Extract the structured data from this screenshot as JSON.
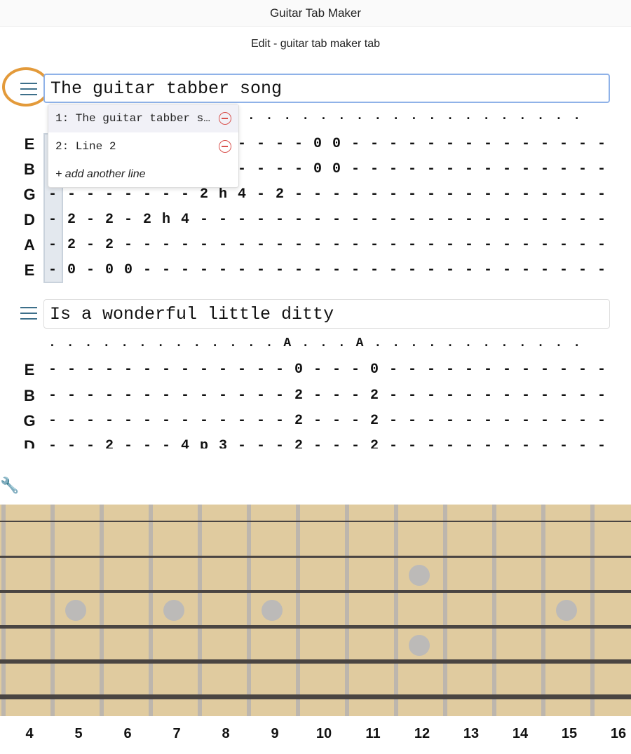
{
  "app_title": "Guitar Tab Maker",
  "page_title": "Edit - guitar tab maker tab",
  "dropdown": {
    "items": [
      {
        "label": "1: The guitar tabber s…"
      },
      {
        "label": "2: Line 2"
      }
    ],
    "add_label": "+  add another line"
  },
  "lines": [
    {
      "title": "The guitar tabber song",
      "focused": true,
      "dots": "..............................",
      "strings": [
        {
          "name": "E",
          "notes": "--------------00--------------"
        },
        {
          "name": "B",
          "notes": "--------------00--------------"
        },
        {
          "name": "G",
          "notes": "--------2h4-2-----------------"
        },
        {
          "name": "D",
          "notes": "-2-2-2h4----------------------"
        },
        {
          "name": "A",
          "notes": "-2-2--------------------------"
        },
        {
          "name": "E",
          "notes": "-0-00-------------------------"
        }
      ]
    },
    {
      "title": "Is a wonderful little ditty",
      "focused": false,
      "dots": ".............A...A............",
      "strings": [
        {
          "name": "E",
          "notes": "-------------0---0------------"
        },
        {
          "name": "B",
          "notes": "-------------2---2------------"
        },
        {
          "name": "G",
          "notes": "-------------2---2------------"
        },
        {
          "name": "D",
          "notes": "---2---4p3---2---2------------"
        }
      ]
    }
  ],
  "fretboard": {
    "fret_numbers": [
      "4",
      "5",
      "6",
      "7",
      "8",
      "9",
      "10",
      "11",
      "12",
      "13",
      "14",
      "15",
      "16"
    ],
    "inlays": [
      5,
      7,
      9,
      12,
      15
    ],
    "color": "#e0cb9f"
  },
  "accent": "#e39a3a"
}
